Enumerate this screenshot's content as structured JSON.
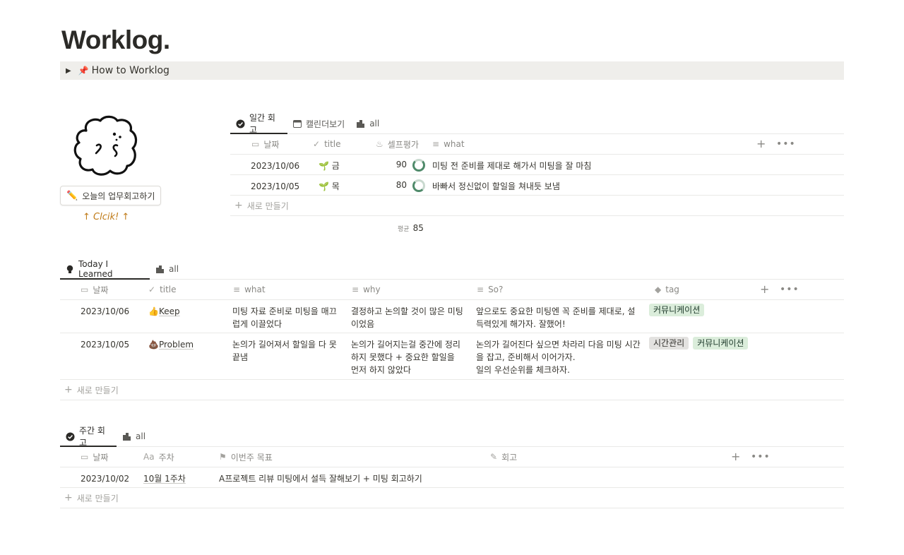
{
  "page": {
    "title": "Worklog.",
    "toggle_label": "How to Worklog",
    "cta_label": "오늘의 업무회고하기",
    "click_note": "↑ Clcik! ↑"
  },
  "daily": {
    "tabs": [
      {
        "label": "일간 회고",
        "icon": "check-circle-icon"
      },
      {
        "label": "캘린더보기",
        "icon": "calendar-icon"
      },
      {
        "label": "all",
        "icon": "stack-icon"
      }
    ],
    "columns": [
      "날짜",
      "title",
      "셀프평가",
      "what"
    ],
    "rows": [
      {
        "date": "2023/10/06",
        "title": "금",
        "score": "90",
        "what": "미팅 전 준비를 제대로 해가서 미팅을 잘 마침"
      },
      {
        "date": "2023/10/05",
        "title": "목",
        "score": "80",
        "what": "바빠서 정신없이 할일을 쳐내듯 보냄"
      }
    ],
    "new_label": "새로 만들기",
    "avg_label": "평균",
    "avg_value": "85"
  },
  "til": {
    "tabs": [
      {
        "label": "Today I Learned",
        "icon": "bulb-icon"
      },
      {
        "label": "all",
        "icon": "stack-icon"
      }
    ],
    "columns": [
      "날짜",
      "title",
      "what",
      "why",
      "So?",
      "tag"
    ],
    "rows": [
      {
        "date": "2023/10/06",
        "title": "Keep",
        "title_emoji": "👍",
        "what": "미팅 자료 준비로 미팅을 매끄럽게 이끌었다",
        "why": "결정하고 논의할 것이 많은 미팅이었음",
        "so": "앞으로도 중요한 미팅엔 꼭 준비를 제대로, 설득력있게 해가자. 잘했어!",
        "tags": [
          "커뮤니케이션"
        ]
      },
      {
        "date": "2023/10/05",
        "title": "Problem",
        "title_emoji": "💩",
        "what": "논의가 길어져서 할일을 다 못 끝냄",
        "why": "논의가 길어지는걸 중간에 정리하지 못했다 + 중요한 할일을 먼저 하지 않았다",
        "so": "논의가 길어진다 싶으면 차라리 다음 미팅 시간을 잡고, 준비해서 이어가자.",
        "so2": "일의 우선순위를 체크하자.",
        "tags": [
          "시간관리",
          "커뮤니케이션"
        ]
      }
    ],
    "new_label": "새로 만들기"
  },
  "weekly": {
    "tabs": [
      {
        "label": "주간 회고",
        "icon": "check-circle-icon"
      },
      {
        "label": "all",
        "icon": "stack-icon"
      }
    ],
    "columns": [
      "날짜",
      "주차",
      "이번주 목표",
      "회고"
    ],
    "rows": [
      {
        "date": "2023/10/02",
        "week": "10월 1주차",
        "goal": "A프로젝트 리뷰 미팅에서 설득 잘해보기 + 미팅 회고하기",
        "review": ""
      }
    ],
    "new_label": "새로 만들기"
  },
  "colors": {
    "accent_text": "#2b2a27",
    "note_orange": "#c07b18",
    "tag_green": "#dbeddb",
    "tag_gray": "#e3e2e0",
    "ring_green": "#4f8a6a"
  }
}
